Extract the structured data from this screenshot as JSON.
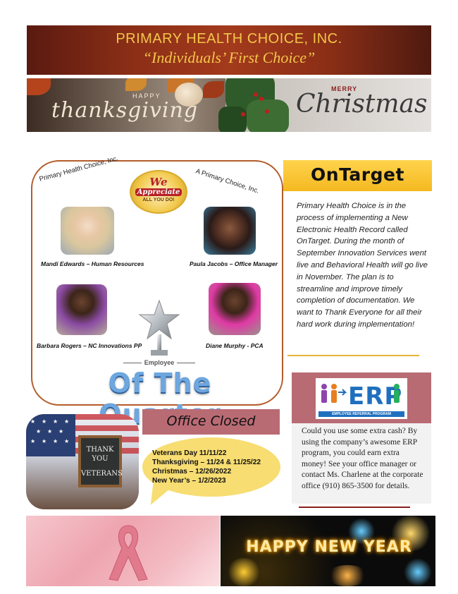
{
  "header": {
    "company": "PRIMARY HEALTH CHOICE, INC.",
    "tagline": "“Individuals’ First Choice”"
  },
  "holiday_banner": {
    "left_small": "HAPPY",
    "left_script": "thanksgiving",
    "right_small": "MERRY",
    "right_script": "Christmas"
  },
  "employee_of_quarter": {
    "arc_left": "Primary Health Choice, Inc.",
    "arc_right": "A Primary Choice, Inc.",
    "badge": {
      "line1": "We",
      "line2": "Appreciate",
      "line3": "ALL YOU DO!"
    },
    "people": [
      {
        "caption": "Mandi Edwards – Human Resources"
      },
      {
        "caption": "Paula Jacobs – Office Manager"
      },
      {
        "caption": "Barbara Rogers – NC Innovations PP"
      },
      {
        "caption": "Diane Murphy - PCA"
      }
    ],
    "employee_label": "Employee",
    "of_quarter": "Of The Quarter"
  },
  "ontarget": {
    "title": "OnTarget",
    "body": "Primary Health Choice is in the process of implementing a New Electronic Health Record called OnTarget. During the month of September Innovation Services went live and Behavioral Health will go live in November. The plan is to streamline and improve timely completion of documentation. We want to Thank Everyone for all their hard work during implementation!"
  },
  "erp": {
    "logo_text": "ERP",
    "logo_sub": "EMPLOYEE REFERRAL PROGRAM",
    "body": "Could you use some extra cash? By using the company’s awesome ERP program, you could earn extra money! See your office manager or contact Ms. Charlene at the corporate office (910) 865-3500 for details."
  },
  "veterans": {
    "sign_line1": "THANK YOU",
    "sign_line2": "VETERANS"
  },
  "office_closed": {
    "title": "Office Closed",
    "items": [
      "Veterans Day 11/11/22",
      "Thanksgiving – 11/24 & 11/25/22",
      "Christmas – 12/26/2022",
      "New Year’s – 1/2/2023"
    ]
  },
  "footer": {
    "new_year_text": "HAPPY NEW YEAR"
  }
}
